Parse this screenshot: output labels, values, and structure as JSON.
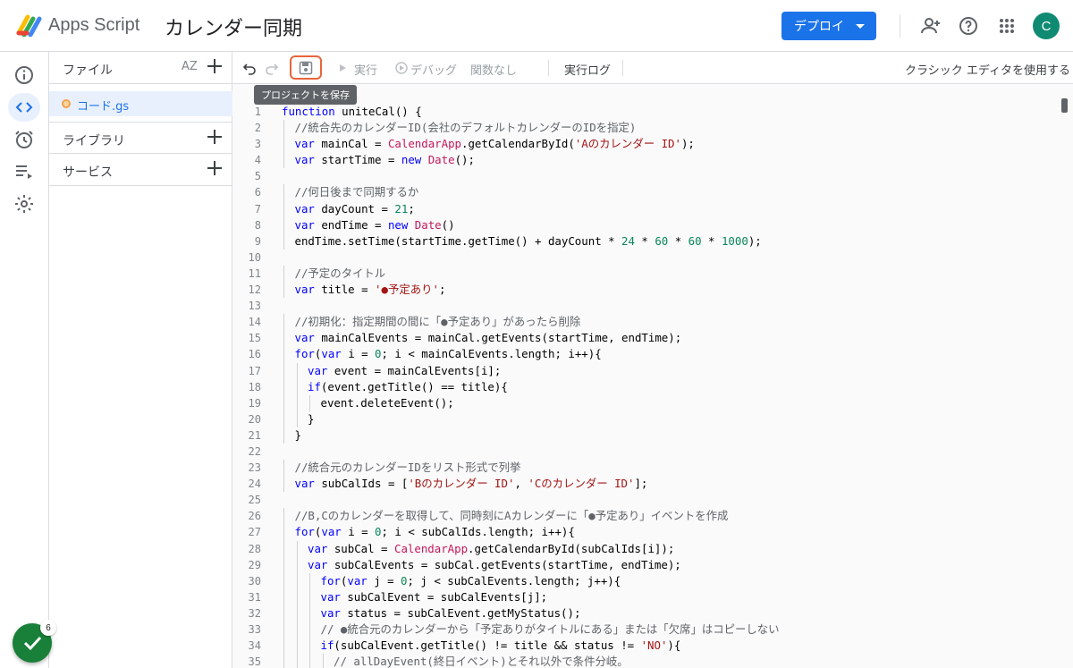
{
  "app": {
    "name": "Apps Script",
    "project_title": "カレンダー同期"
  },
  "header": {
    "deploy_label": "デプロイ",
    "avatar_initial": "C"
  },
  "files_panel": {
    "files_label": "ファイル",
    "sort_label": "AZ",
    "file_name": "コード.gs",
    "libraries_label": "ライブラリ",
    "services_label": "サービス"
  },
  "toolbar": {
    "run_label": "実行",
    "debug_label": "デバッグ",
    "function_select": "関数なし",
    "exec_log_label": "実行ログ",
    "classic_editor_label": "クラシック エディタを使用する",
    "save_tooltip": "プロジェクトを保存"
  },
  "status": {
    "badge_count": "6"
  },
  "colors": {
    "accent": "#1a73e8",
    "avatar": "#0f8a73",
    "highlight": "#e8653a",
    "fab": "#188038"
  },
  "code_lines": [
    {
      "n": "1",
      "indent": 0,
      "t": [
        [
          "kw",
          "function "
        ],
        [
          "def",
          "uniteCal() {"
        ]
      ]
    },
    {
      "n": "2",
      "indent": 1,
      "t": [
        [
          "cm",
          "//統合先のカレンダーID(会社のデフォルトカレンダーのIDを指定)"
        ]
      ]
    },
    {
      "n": "3",
      "indent": 1,
      "t": [
        [
          "kw",
          "var "
        ],
        [
          "def",
          "mainCal = "
        ],
        [
          "cls",
          "CalendarApp"
        ],
        [
          "def",
          ".getCalendarById("
        ],
        [
          "str",
          "'Aのカレンダー ID'"
        ],
        [
          "def",
          ");"
        ]
      ]
    },
    {
      "n": "4",
      "indent": 1,
      "t": [
        [
          "kw",
          "var "
        ],
        [
          "def",
          "startTime = "
        ],
        [
          "kw",
          "new "
        ],
        [
          "cls",
          "Date"
        ],
        [
          "def",
          "();"
        ]
      ]
    },
    {
      "n": "5",
      "indent": 0,
      "t": []
    },
    {
      "n": "6",
      "indent": 1,
      "t": [
        [
          "cm",
          "//何日後まで同期するか"
        ]
      ]
    },
    {
      "n": "7",
      "indent": 1,
      "t": [
        [
          "kw",
          "var "
        ],
        [
          "def",
          "dayCount = "
        ],
        [
          "num",
          "21"
        ],
        [
          "def",
          ";"
        ]
      ]
    },
    {
      "n": "8",
      "indent": 1,
      "t": [
        [
          "kw",
          "var "
        ],
        [
          "def",
          "endTime = "
        ],
        [
          "kw",
          "new "
        ],
        [
          "cls",
          "Date"
        ],
        [
          "def",
          "()"
        ]
      ]
    },
    {
      "n": "9",
      "indent": 1,
      "t": [
        [
          "def",
          "endTime.setTime(startTime.getTime() + dayCount * "
        ],
        [
          "num",
          "24"
        ],
        [
          "def",
          " * "
        ],
        [
          "num",
          "60"
        ],
        [
          "def",
          " * "
        ],
        [
          "num",
          "60"
        ],
        [
          "def",
          " * "
        ],
        [
          "num",
          "1000"
        ],
        [
          "def",
          ");"
        ]
      ]
    },
    {
      "n": "10",
      "indent": 0,
      "t": []
    },
    {
      "n": "11",
      "indent": 1,
      "t": [
        [
          "cm",
          "//予定のタイトル"
        ]
      ]
    },
    {
      "n": "12",
      "indent": 1,
      "t": [
        [
          "kw",
          "var "
        ],
        [
          "def",
          "title = "
        ],
        [
          "str",
          "'●予定あり'"
        ],
        [
          "def",
          ";"
        ]
      ]
    },
    {
      "n": "13",
      "indent": 0,
      "t": []
    },
    {
      "n": "14",
      "indent": 1,
      "t": [
        [
          "cm",
          "//初期化：指定期間の間に「●予定あり」があったら削除"
        ]
      ]
    },
    {
      "n": "15",
      "indent": 1,
      "t": [
        [
          "kw",
          "var "
        ],
        [
          "def",
          "mainCalEvents = mainCal.getEvents(startTime, endTime);"
        ]
      ]
    },
    {
      "n": "16",
      "indent": 1,
      "t": [
        [
          "kw",
          "for"
        ],
        [
          "def",
          "("
        ],
        [
          "kw",
          "var "
        ],
        [
          "def",
          "i = "
        ],
        [
          "num",
          "0"
        ],
        [
          "def",
          "; i < mainCalEvents.length; i++){"
        ]
      ]
    },
    {
      "n": "17",
      "indent": 2,
      "t": [
        [
          "kw",
          "var "
        ],
        [
          "def",
          "event = mainCalEvents[i];"
        ]
      ]
    },
    {
      "n": "18",
      "indent": 2,
      "t": [
        [
          "kw",
          "if"
        ],
        [
          "def",
          "(event.getTitle() == title){"
        ]
      ]
    },
    {
      "n": "19",
      "indent": 3,
      "t": [
        [
          "def",
          "event.deleteEvent();"
        ]
      ]
    },
    {
      "n": "20",
      "indent": 2,
      "t": [
        [
          "def",
          "}"
        ]
      ]
    },
    {
      "n": "21",
      "indent": 1,
      "t": [
        [
          "def",
          "}"
        ]
      ]
    },
    {
      "n": "22",
      "indent": 0,
      "t": []
    },
    {
      "n": "23",
      "indent": 1,
      "t": [
        [
          "cm",
          "//統合元のカレンダーIDをリスト形式で列挙"
        ]
      ]
    },
    {
      "n": "24",
      "indent": 1,
      "t": [
        [
          "kw",
          "var "
        ],
        [
          "def",
          "subCalIds = ["
        ],
        [
          "str",
          "'Bのカレンダー ID'"
        ],
        [
          "def",
          ", "
        ],
        [
          "str",
          "'Cのカレンダー ID'"
        ],
        [
          "def",
          "];"
        ]
      ]
    },
    {
      "n": "25",
      "indent": 0,
      "t": []
    },
    {
      "n": "26",
      "indent": 1,
      "t": [
        [
          "cm",
          "//B,Cのカレンダーを取得して、同時刻にAカレンダーに「●予定あり」イベントを作成"
        ]
      ]
    },
    {
      "n": "27",
      "indent": 1,
      "t": [
        [
          "kw",
          "for"
        ],
        [
          "def",
          "("
        ],
        [
          "kw",
          "var "
        ],
        [
          "def",
          "i = "
        ],
        [
          "num",
          "0"
        ],
        [
          "def",
          "; i < subCalIds.length; i++){"
        ]
      ]
    },
    {
      "n": "28",
      "indent": 2,
      "t": [
        [
          "kw",
          "var "
        ],
        [
          "def",
          "subCal = "
        ],
        [
          "cls",
          "CalendarApp"
        ],
        [
          "def",
          ".getCalendarById(subCalIds[i]);"
        ]
      ]
    },
    {
      "n": "29",
      "indent": 2,
      "t": [
        [
          "kw",
          "var "
        ],
        [
          "def",
          "subCalEvents = subCal.getEvents(startTime, endTime);"
        ]
      ]
    },
    {
      "n": "30",
      "indent": 3,
      "t": [
        [
          "kw",
          "for"
        ],
        [
          "def",
          "("
        ],
        [
          "kw",
          "var "
        ],
        [
          "def",
          "j = "
        ],
        [
          "num",
          "0"
        ],
        [
          "def",
          "; j < subCalEvents.length; j++){"
        ]
      ]
    },
    {
      "n": "31",
      "indent": 3,
      "t": [
        [
          "kw",
          "var "
        ],
        [
          "def",
          "subCalEvent = subCalEvents[j];"
        ]
      ]
    },
    {
      "n": "32",
      "indent": 3,
      "t": [
        [
          "kw",
          "var "
        ],
        [
          "def",
          "status = subCalEvent.getMyStatus();"
        ]
      ]
    },
    {
      "n": "33",
      "indent": 3,
      "t": [
        [
          "cm",
          "// ●統合元のカレンダーから「予定ありがタイトルにある」または「欠席」はコピーしない"
        ]
      ]
    },
    {
      "n": "34",
      "indent": 3,
      "t": [
        [
          "kw",
          "if"
        ],
        [
          "def",
          "(subCalEvent.getTitle() != title && status != "
        ],
        [
          "str",
          "'NO'"
        ],
        [
          "def",
          "){"
        ]
      ]
    },
    {
      "n": "35",
      "indent": 4,
      "t": [
        [
          "cm",
          "// allDayEvent(終日イベント)とそれ以外で条件分岐。"
        ]
      ]
    }
  ]
}
